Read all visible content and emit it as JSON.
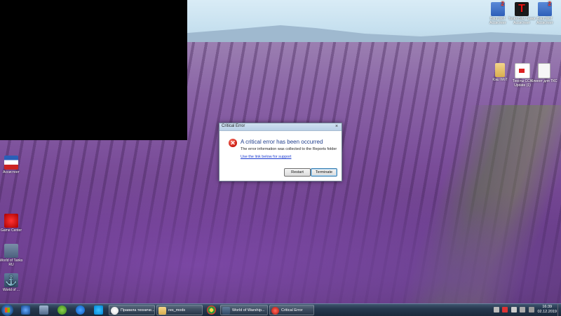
{
  "dialog": {
    "title": "Critical Error",
    "close_glyph": "×",
    "icon_glyph": "✕",
    "heading": "A critical error has been occurred",
    "info": "The error information was collected to the Reports folder",
    "link": "Use the link below for support",
    "restart_label": "Restart",
    "terminate_label": "Terminate"
  },
  "desktop_icons": [
    {
      "label": "Ваш WoT Ассистент"
    },
    {
      "label": "Tanks Blitz Танки Ассистент"
    },
    {
      "label": "Ваш WoT Ассистент"
    },
    {
      "label": "Кэш WoT"
    },
    {
      "label": "Тексты CCK Update (1)"
    },
    {
      "label": "Клиент для ТКС"
    },
    {
      "label": "Ассистент"
    },
    {
      "label": "Game Center"
    },
    {
      "label": "World of Tanks RU"
    },
    {
      "label": "World of ..."
    }
  ],
  "taskbar": {
    "pinned": [
      "start-icon",
      "thunder-icon",
      "shield-icon",
      "uTorrent-icon",
      "teamviewer-icon",
      "skype-icon"
    ],
    "windows": [
      {
        "label": "Правила техниче..."
      },
      {
        "label": "res_mods"
      },
      {
        "label": "World of Warship..."
      },
      {
        "label": "Critical Error"
      }
    ],
    "clock_time": "16:39",
    "clock_date": "02.12.2019"
  },
  "colors": {
    "dialog_heading": "#1f3d8c",
    "link": "#1a3ad0",
    "taskbar": "#25384e"
  }
}
